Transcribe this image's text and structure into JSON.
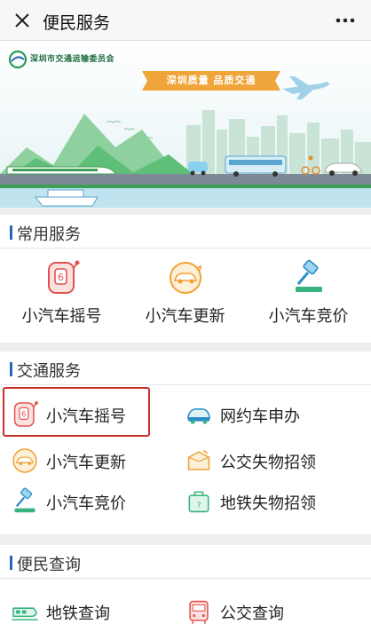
{
  "header": {
    "title": "便民服务",
    "close_icon": "close-icon",
    "more_icon": "more-dots-icon"
  },
  "banner": {
    "org_name": "深圳市交通运输委员会",
    "slogan": "深圳质量  品质交通"
  },
  "sections": {
    "common": {
      "title": "常用服务",
      "items": [
        {
          "label": "小汽车摇号",
          "icon": "lottery-machine-icon"
        },
        {
          "label": "小汽车更新",
          "icon": "car-renew-icon"
        },
        {
          "label": "小汽车竞价",
          "icon": "auction-gavel-icon"
        }
      ]
    },
    "traffic": {
      "title": "交通服务",
      "items": [
        {
          "label": "小汽车摇号",
          "icon": "lottery-machine-icon",
          "highlighted": true
        },
        {
          "label": "网约车申办",
          "icon": "ride-hailing-car-icon"
        },
        {
          "label": "小汽车更新",
          "icon": "car-renew-icon"
        },
        {
          "label": "公交失物招领",
          "icon": "lost-box-icon"
        },
        {
          "label": "小汽车竞价",
          "icon": "auction-gavel-icon"
        },
        {
          "label": "地铁失物招领",
          "icon": "metro-lost-bag-icon"
        }
      ]
    },
    "query": {
      "title": "便民查询",
      "items": [
        {
          "label": "地铁查询",
          "icon": "metro-train-icon"
        },
        {
          "label": "公交查询",
          "icon": "bus-icon"
        }
      ]
    }
  },
  "colors": {
    "accent_blue": "#2a64b7",
    "highlight_red": "#c8302c",
    "icon_orange": "#f0a136",
    "icon_green": "#36b37e",
    "icon_red": "#e0544f"
  }
}
